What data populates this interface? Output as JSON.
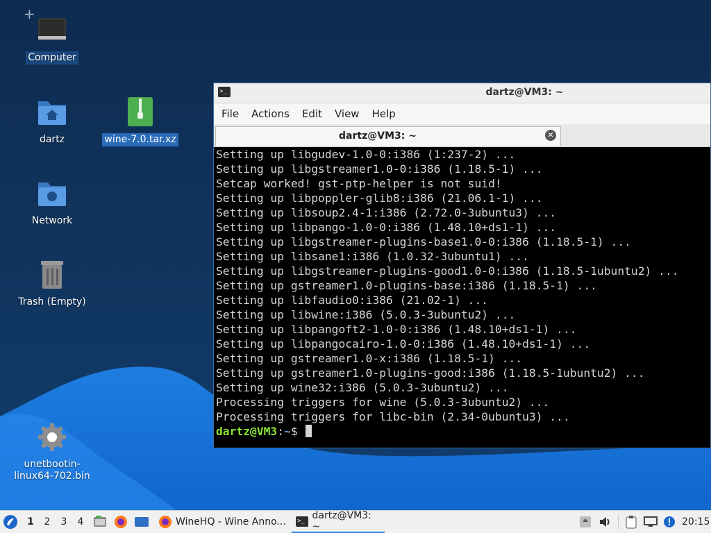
{
  "desktop": {
    "icons": [
      {
        "label": "Computer",
        "icon": "computer-icon"
      },
      {
        "label": "dartz",
        "icon": "home-folder-icon"
      },
      {
        "label": "wine-7.0.tar.xz",
        "icon": "archive-file-icon"
      },
      {
        "label": "Network",
        "icon": "network-folder-icon"
      },
      {
        "label": "Trash (Empty)",
        "icon": "trash-icon"
      },
      {
        "label": "unetbootin-\nlinux64-702.bin",
        "icon": "settings-gear-icon"
      }
    ]
  },
  "terminal": {
    "window_title": "dartz@VM3: ~",
    "menu": [
      "File",
      "Actions",
      "Edit",
      "View",
      "Help"
    ],
    "tab_title": "dartz@VM3: ~",
    "lines": [
      "Setting up libgudev-1.0-0:i386 (1:237-2) ...",
      "Setting up libgstreamer1.0-0:i386 (1.18.5-1) ...",
      "Setcap worked! gst-ptp-helper is not suid!",
      "Setting up libpoppler-glib8:i386 (21.06.1-1) ...",
      "Setting up libsoup2.4-1:i386 (2.72.0-3ubuntu3) ...",
      "Setting up libpango-1.0-0:i386 (1.48.10+ds1-1) ...",
      "Setting up libgstreamer-plugins-base1.0-0:i386 (1.18.5-1) ...",
      "Setting up libsane1:i386 (1.0.32-3ubuntu1) ...",
      "Setting up libgstreamer-plugins-good1.0-0:i386 (1.18.5-1ubuntu2) ...",
      "Setting up gstreamer1.0-plugins-base:i386 (1.18.5-1) ...",
      "Setting up libfaudio0:i386 (21.02-1) ...",
      "Setting up libwine:i386 (5.0.3-3ubuntu2) ...",
      "Setting up libpangoft2-1.0-0:i386 (1.48.10+ds1-1) ...",
      "Setting up libpangocairo-1.0-0:i386 (1.48.10+ds1-1) ...",
      "Setting up gstreamer1.0-x:i386 (1.18.5-1) ...",
      "Setting up gstreamer1.0-plugins-good:i386 (1.18.5-1ubuntu2) ...",
      "Setting up wine32:i386 (5.0.3-3ubuntu2) ...",
      "Processing triggers for wine (5.0.3-3ubuntu2) ...",
      "Processing triggers for libc-bin (2.34-0ubuntu3) ..."
    ],
    "prompt_user": "dartz@VM3",
    "prompt_sep": ":",
    "prompt_path": "~",
    "prompt_symbol": "$ "
  },
  "taskbar": {
    "workspaces": [
      "1",
      "2",
      "3",
      "4"
    ],
    "active_workspace": "1",
    "tasks": [
      {
        "label": "WineHQ - Wine Anno...",
        "icon": "firefox-icon"
      },
      {
        "label": "dartz@VM3: ~",
        "icon": "terminal-icon"
      }
    ],
    "clock": "20:15"
  },
  "colors": {
    "prompt_user": "#8ae234",
    "prompt_path": "#729fcf",
    "accent": "#3584e4"
  }
}
